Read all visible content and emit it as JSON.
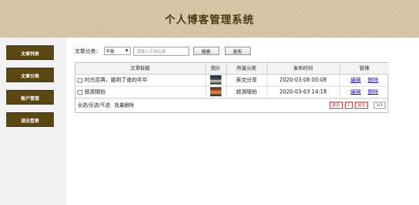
{
  "header": {
    "title": "个人博客管理系统"
  },
  "colors": {
    "header_bg": "#d9c7a5",
    "sidebar_button": "#5b4712",
    "link": "#1a0dcc",
    "pager_accent": "#cc3333"
  },
  "sidebar": {
    "items": [
      {
        "label": "文章列表"
      },
      {
        "label": "文章分类"
      },
      {
        "label": "账户管理"
      },
      {
        "label": "退出登录"
      }
    ]
  },
  "toolbar": {
    "category_label": "文章分类：",
    "category_selected": "不限",
    "search_placeholder": "请输入文章标题",
    "search_button": "搜索",
    "publish_button": "发布"
  },
  "table": {
    "headers": [
      "文章标题",
      "图片",
      "所属分类",
      "发布时间",
      "管理"
    ],
    "rows": [
      {
        "title": "时光荏苒，跳到了谁的年华",
        "category": "美文分享",
        "date": "2020-03-08 00:08",
        "edit": "编辑",
        "delete": "删除"
      },
      {
        "title": "旅游随拍",
        "category": "旅游随拍",
        "date": "2020-03-03 14:18",
        "edit": "编辑",
        "delete": "删除"
      }
    ]
  },
  "footer": {
    "select_actions": "全选/反选/不选",
    "batch_delete": "批量删除",
    "pager": {
      "first": "首页",
      "current": "1",
      "last": "尾页",
      "total": "1/1"
    }
  }
}
